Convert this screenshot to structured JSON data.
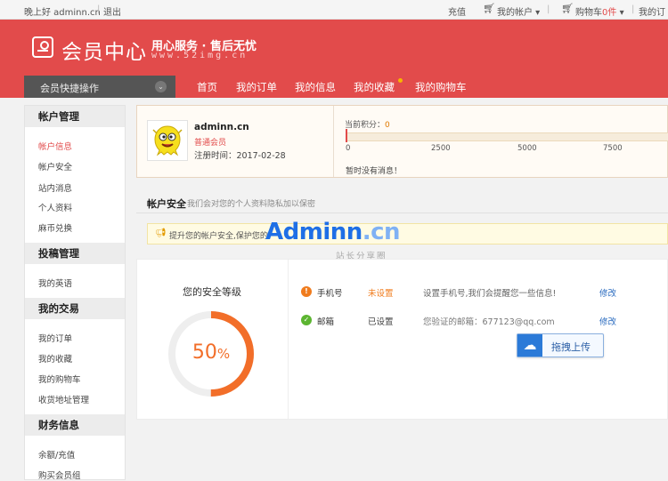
{
  "topbar": {
    "greeting": "晚上好 adminn.cn",
    "sep": "|",
    "logout": "退出",
    "recharge": "充值",
    "my_account": "我的帐户 ▾",
    "cart_label": "购物车",
    "cart_count": "0件",
    "cart_caret": "▾",
    "my_orders": "我的订"
  },
  "header": {
    "title": "会员中心",
    "slogan": "用心服务 · 售后无忧",
    "url": "www.52img.cn",
    "quick_ops": "会员快捷操作",
    "quick_chevron": "⌄",
    "nav": [
      "首页",
      "我的订单",
      "我的信息",
      "我的收藏",
      "我的购物车"
    ]
  },
  "sidebar": {
    "groups": [
      {
        "title": "帐户管理",
        "items": [
          "帐户信息",
          "帐户安全",
          "站内消息",
          "个人资料",
          "麻币兑换"
        ]
      },
      {
        "title": "投稿管理",
        "items": [
          "我的英语"
        ]
      },
      {
        "title": "我的交易",
        "items": [
          "我的订单",
          "我的收藏",
          "我的购物车",
          "收货地址管理"
        ]
      },
      {
        "title": "财务信息",
        "items": [
          "余额/充值",
          "购买会员组"
        ]
      }
    ]
  },
  "profile": {
    "name": "adminn.cn",
    "level": "普通会员",
    "register_date": "注册时间：2017-02-28",
    "points_label": "当前积分：",
    "points_value": "0",
    "points_progress": 0,
    "ticks": [
      "0",
      "2500",
      "5000",
      "7500"
    ],
    "no_messages": "暂时没有消息！"
  },
  "security": {
    "title": "帐户安全",
    "subtitle": "我们会对您的个人资料隐私加以保密",
    "warning": "提升您的帐户安全,保护您的",
    "level_title": "您的安全等级",
    "level_number": "50",
    "level_percent_sign": "%",
    "level_value": 50,
    "rows": [
      {
        "icon": "!",
        "label": "手机号",
        "status": "未设置",
        "desc": "设置手机号,我们会提醒您一些信息!",
        "action": "修改"
      },
      {
        "icon": "✓",
        "label": "邮箱",
        "status": "已设置",
        "desc": "您验证的邮箱：677123@qq.com",
        "action": "修改"
      }
    ],
    "upload_label": "拖拽上传"
  },
  "watermark": {
    "brand_a": "Adminn",
    "brand_b": ".cn",
    "sub": "站长分享圈"
  },
  "colors": {
    "brand_red": "#e24b4b",
    "ring_orange": "#f26e29",
    "ring_track": "#eeeeee",
    "warn_orange": "#f07c1e",
    "ok_green": "#5cb531"
  }
}
